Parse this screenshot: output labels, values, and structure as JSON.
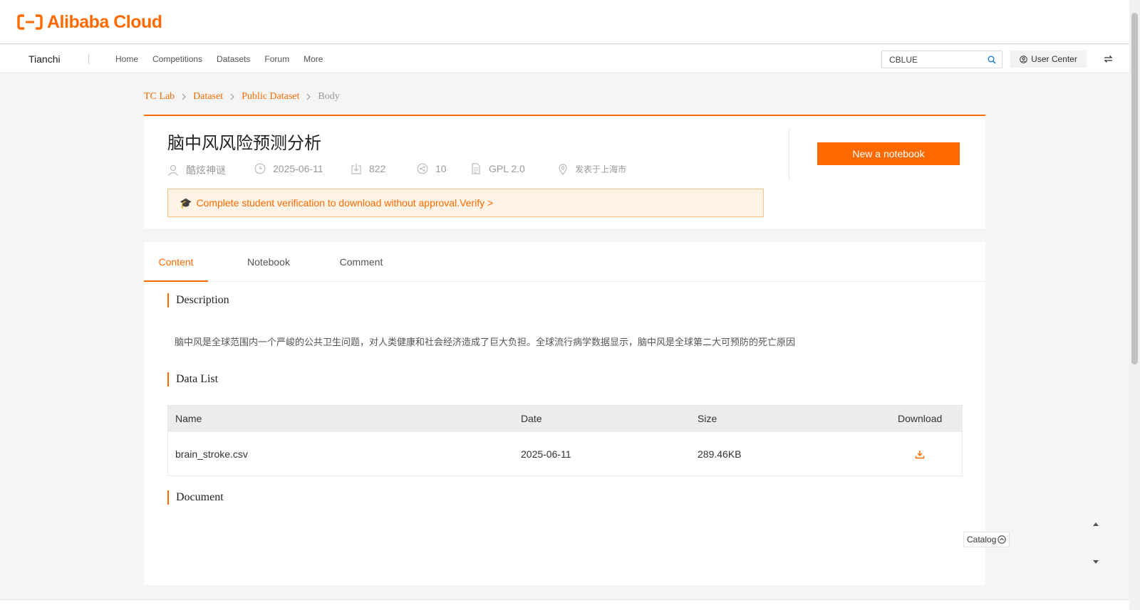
{
  "brand": {
    "logo_text": "Alibaba Cloud",
    "accent_color": "#ff6a00"
  },
  "nav": {
    "brand": "Tianchi",
    "links": [
      "Home",
      "Competitions",
      "Datasets",
      "Forum",
      "More"
    ],
    "search_value": "CBLUE",
    "user_center": "User Center"
  },
  "breadcrumb": {
    "items": [
      "TC Lab",
      "Dataset",
      "Public Dataset"
    ],
    "current": "Body"
  },
  "dataset": {
    "title": "脑中风风险预测分析",
    "author": "酷炫神谜",
    "date": "2025-06-11",
    "downloads": "822",
    "shares": "10",
    "license": "GPL 2.0",
    "location": "发表于上海市",
    "new_notebook": "New a notebook",
    "notice_text": "Complete student verification to download without approval.",
    "notice_link": "Verify >"
  },
  "tabs": [
    "Content",
    "Notebook",
    "Comment"
  ],
  "sections": {
    "description_title": "Description",
    "description_text": "脑中风是全球范围内一个严峻的公共卫生问题，对人类健康和社会经济造成了巨大负担。全球流行病学数据显示，脑中风是全球第二大可预防的死亡原因",
    "data_list_title": "Data List",
    "document_title": "Document"
  },
  "table": {
    "headers": [
      "Name",
      "Date",
      "Size",
      "Download"
    ],
    "rows": [
      {
        "name": "brain_stroke.csv",
        "date": "2025-06-11",
        "size": "289.46KB"
      }
    ]
  },
  "catalog": {
    "label": "Catalog"
  }
}
